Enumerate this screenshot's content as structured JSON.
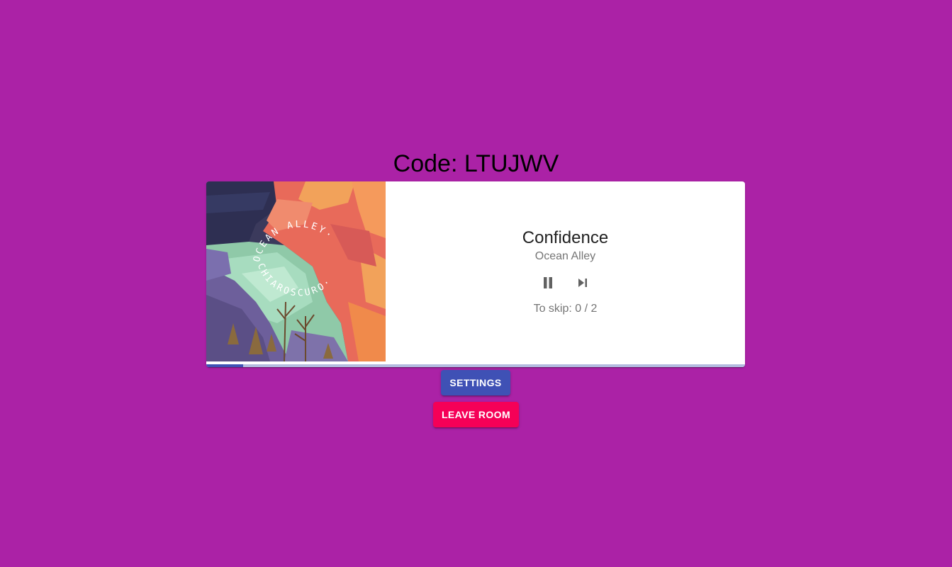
{
  "room": {
    "code_text": "Code: LTUJWV"
  },
  "player": {
    "title": "Confidence",
    "artist": "Ocean Alley",
    "album_art_text": "OCEAN ALLEY · CHIAROSCURO ·",
    "controls": {
      "play_pause_icon": "pause-icon",
      "skip_icon": "skip-next-icon"
    },
    "skip_text": "To skip: 0 / 2",
    "progress_fraction": 0.068
  },
  "buttons": {
    "settings_label": "SETTINGS",
    "leave_label": "LEAVE ROOM"
  },
  "colors": {
    "background": "#ab22a6",
    "primary": "#3f51b5",
    "secondary": "#f50057",
    "progress_track": "#b3bbdf"
  }
}
